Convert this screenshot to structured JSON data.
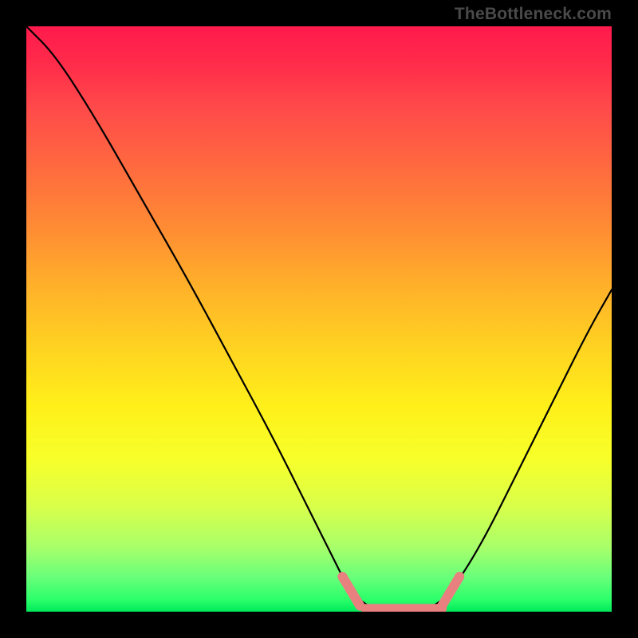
{
  "attribution": "TheBottleneck.com",
  "colors": {
    "curve": "#000000",
    "highlight": "#e98080",
    "background": "#000000"
  },
  "chart_data": {
    "type": "line",
    "title": "",
    "xlabel": "",
    "ylabel": "",
    "xlim": [
      0,
      100
    ],
    "ylim": [
      0,
      100
    ],
    "curve": [
      {
        "x": 0,
        "y": 100
      },
      {
        "x": 5,
        "y": 95
      },
      {
        "x": 12,
        "y": 84
      },
      {
        "x": 20,
        "y": 70
      },
      {
        "x": 28,
        "y": 56
      },
      {
        "x": 35,
        "y": 43
      },
      {
        "x": 42,
        "y": 30
      },
      {
        "x": 48,
        "y": 18
      },
      {
        "x": 52,
        "y": 10
      },
      {
        "x": 55,
        "y": 4
      },
      {
        "x": 58,
        "y": 1
      },
      {
        "x": 62,
        "y": 0
      },
      {
        "x": 66,
        "y": 0
      },
      {
        "x": 70,
        "y": 1
      },
      {
        "x": 73,
        "y": 4
      },
      {
        "x": 78,
        "y": 12
      },
      {
        "x": 84,
        "y": 24
      },
      {
        "x": 90,
        "y": 36
      },
      {
        "x": 96,
        "y": 48
      },
      {
        "x": 100,
        "y": 55
      }
    ],
    "highlight_segments": [
      {
        "x1": 54,
        "y1": 6,
        "x2": 57,
        "y2": 1
      },
      {
        "x1": 58,
        "y1": 0.5,
        "x2": 71,
        "y2": 0.5
      },
      {
        "x1": 71,
        "y1": 1,
        "x2": 74,
        "y2": 6
      }
    ]
  }
}
